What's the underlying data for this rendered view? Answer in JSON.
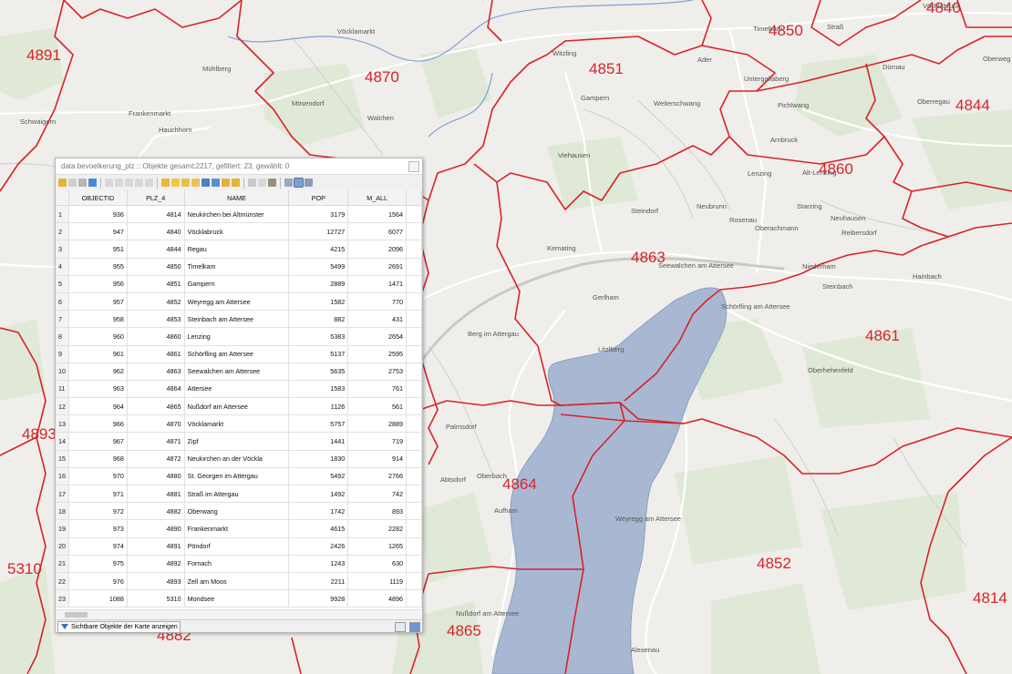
{
  "map": {
    "plz_labels": [
      "4840",
      "4850",
      "4891",
      "4870",
      "4851",
      "4844",
      "4860",
      "4863",
      "4893",
      "4861",
      "4864",
      "5310",
      "4852",
      "4814",
      "4865",
      "4882"
    ],
    "places": [
      "Vöcklabruck",
      "Vöcklamarkt",
      "Timelkam",
      "Straß",
      "Witzling",
      "Ader",
      "Dürnau",
      "Oberweg",
      "Mühlberg",
      "Untergallaberg",
      "Oberregau",
      "Frankenmarkt",
      "Mösendorf",
      "Gampern",
      "Weiterschwang",
      "Pichlwang",
      "Schwaigern",
      "Hauchhorn",
      "Walchen",
      "Arnbruck",
      "Viehausen",
      "Lenzing",
      "Alt-Lenzing",
      "Steindorf",
      "Neubrunn",
      "Starzing",
      "Rosenau",
      "Neuhausen",
      "Oberachmann",
      "Reibersdorf",
      "Kemating",
      "Seewalchen am Attersee",
      "Niederham",
      "Hainbach",
      "Gerlham",
      "Steinbach",
      "Schörfling am Attersee",
      "Berg im Attergau",
      "Litzlberg",
      "Oberhehenfeld",
      "Palmsdorf",
      "Abtsdorf",
      "Oberbach",
      "Aufham",
      "Weyregg am Attersee",
      "Nußdorf am Attersee",
      "Alexenau"
    ]
  },
  "attribute_table": {
    "title": "data bevoelkerung_plz :: Objekte gesamt:2217, gefiltert: 23, gewählt: 0",
    "columns": [
      "OBJECTID",
      "PLZ_4",
      "NAME",
      "POP",
      "M_ALL"
    ],
    "rows": [
      [
        "1",
        "936",
        "4814",
        "Neukirchen bei Altmünster",
        "3179",
        "1564"
      ],
      [
        "2",
        "947",
        "4840",
        "Vöcklabruck",
        "12727",
        "6077"
      ],
      [
        "3",
        "951",
        "4844",
        "Regau",
        "4215",
        "2096"
      ],
      [
        "4",
        "955",
        "4850",
        "Timelkam",
        "5499",
        "2691"
      ],
      [
        "5",
        "956",
        "4851",
        "Gampern",
        "2889",
        "1471"
      ],
      [
        "6",
        "957",
        "4852",
        "Weyregg am Attersee",
        "1582",
        "770"
      ],
      [
        "7",
        "958",
        "4853",
        "Steinbach am Attersee",
        "882",
        "431"
      ],
      [
        "8",
        "960",
        "4860",
        "Lenzing",
        "5383",
        "2654"
      ],
      [
        "9",
        "961",
        "4861",
        "Schörfling am Attersee",
        "5137",
        "2595"
      ],
      [
        "10",
        "962",
        "4863",
        "Seewalchen am Attersee",
        "5635",
        "2753"
      ],
      [
        "11",
        "963",
        "4864",
        "Attersee",
        "1583",
        "761"
      ],
      [
        "12",
        "964",
        "4865",
        "Nußdorf am Attersee",
        "1126",
        "561"
      ],
      [
        "13",
        "966",
        "4870",
        "Vöcklamarkt",
        "5757",
        "2889"
      ],
      [
        "14",
        "967",
        "4871",
        "Zipf",
        "1441",
        "719"
      ],
      [
        "15",
        "968",
        "4872",
        "Neukirchen an der Vöckla",
        "1830",
        "914"
      ],
      [
        "16",
        "970",
        "4880",
        "St. Georgen im Attergau",
        "5492",
        "2766"
      ],
      [
        "17",
        "971",
        "4881",
        "Straß im Attergau",
        "1492",
        "742"
      ],
      [
        "18",
        "972",
        "4882",
        "Oberwang",
        "1742",
        "893"
      ],
      [
        "19",
        "973",
        "4890",
        "Frankenmarkt",
        "4615",
        "2282"
      ],
      [
        "20",
        "974",
        "4891",
        "Pöndorf",
        "2426",
        "1265"
      ],
      [
        "21",
        "975",
        "4892",
        "Fornach",
        "1243",
        "630"
      ],
      [
        "22",
        "976",
        "4893",
        "Zell am Moos",
        "2211",
        "1119"
      ],
      [
        "23",
        "1088",
        "5310",
        "Mondsee",
        "9928",
        "4896"
      ]
    ],
    "filter_button_label": "Sichtbare Objekte der Karte anzeigen"
  },
  "colors": {
    "boundary": "#d8232a",
    "lake": "#a8b8d3",
    "water_line": "#6d8fd0"
  }
}
